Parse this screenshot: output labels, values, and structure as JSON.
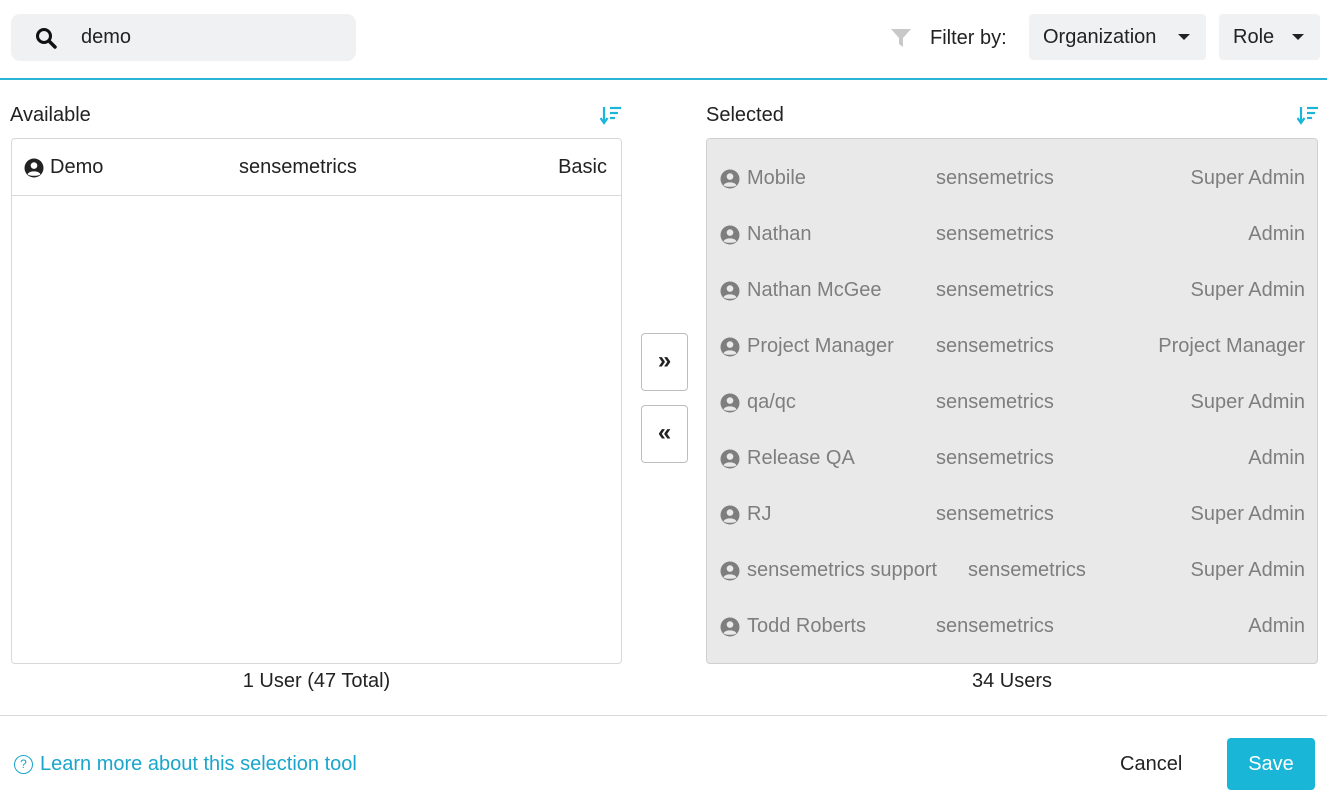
{
  "search": {
    "value": "demo"
  },
  "filter": {
    "label": "Filter by:",
    "organization": "Organization",
    "role": "Role"
  },
  "available": {
    "title": "Available",
    "rows": [
      {
        "name": "Demo",
        "org": "sensemetrics",
        "role": "Basic"
      }
    ],
    "count": "1 User (47 Total)"
  },
  "selected": {
    "title": "Selected",
    "rows": [
      {
        "name": "Mobile",
        "org": "sensemetrics",
        "role": "Super Admin"
      },
      {
        "name": "Nathan",
        "org": "sensemetrics",
        "role": "Admin"
      },
      {
        "name": "Nathan McGee",
        "org": "sensemetrics",
        "role": "Super Admin"
      },
      {
        "name": "Project Manager",
        "org": "sensemetrics",
        "role": "Project Manager"
      },
      {
        "name": "qa/qc",
        "org": "sensemetrics",
        "role": "Super Admin"
      },
      {
        "name": "Release QA",
        "org": "sensemetrics",
        "role": "Admin"
      },
      {
        "name": "RJ",
        "org": "sensemetrics",
        "role": "Super Admin"
      },
      {
        "name": "sensemetrics support",
        "org": "sensemetrics",
        "role": "Super Admin"
      },
      {
        "name": "Todd Roberts",
        "org": "sensemetrics",
        "role": "Admin"
      }
    ],
    "count": "34 Users"
  },
  "move": {
    "add": "»",
    "remove": "«"
  },
  "footer": {
    "learn": "Learn more about this selection tool",
    "help_glyph": "?",
    "cancel": "Cancel",
    "save": "Save"
  },
  "colors": {
    "accent": "#1ab6d8",
    "selected_bg": "#e9e9e9",
    "muted_text": "#7e7e7e"
  },
  "icons": {
    "search": "search-icon",
    "filter": "filter-funnel-icon",
    "sort": "sort-icon",
    "user": "user-circle-icon"
  }
}
